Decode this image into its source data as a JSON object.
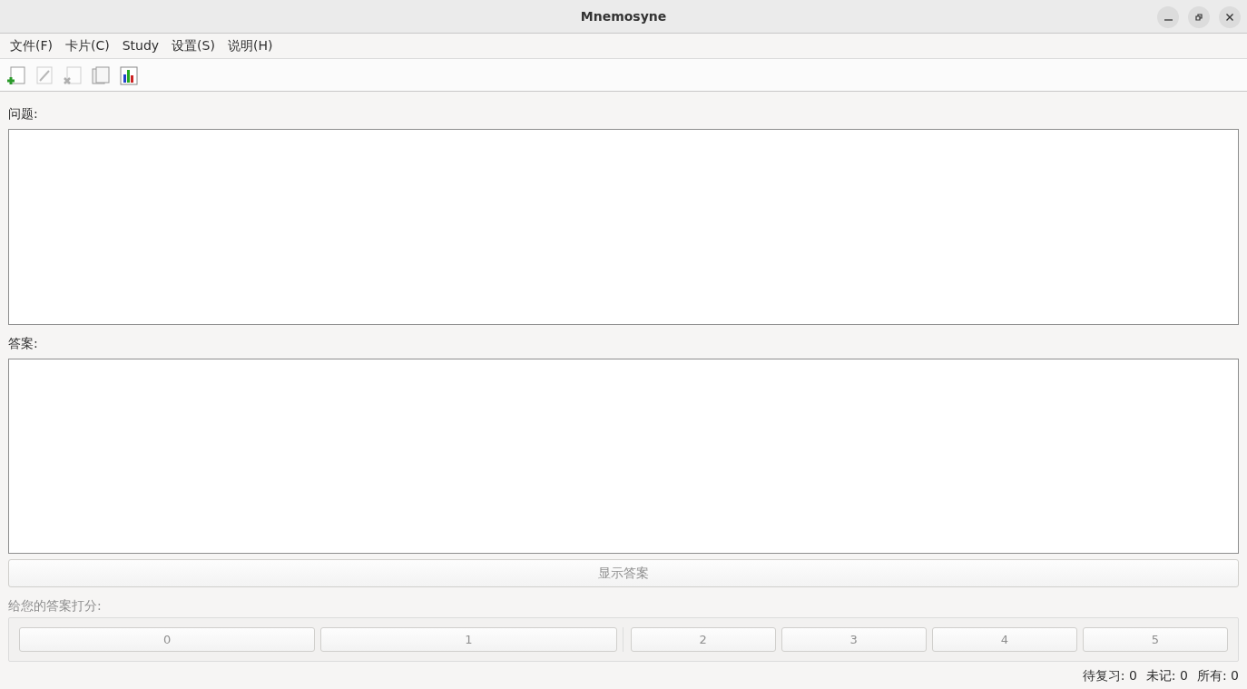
{
  "window": {
    "title": "Mnemosyne"
  },
  "menu": [
    {
      "label": "文件(F)"
    },
    {
      "label": "卡片(C)"
    },
    {
      "label": "Study"
    },
    {
      "label": "设置(S)"
    },
    {
      "label": "说明(H)"
    }
  ],
  "toolbar": [
    {
      "kind": "add",
      "disabled": false
    },
    {
      "kind": "edit",
      "disabled": true
    },
    {
      "kind": "delete",
      "disabled": true
    },
    {
      "kind": "copy",
      "disabled": false
    },
    {
      "kind": "stats",
      "disabled": false
    }
  ],
  "question": {
    "label": "问题:"
  },
  "answer": {
    "label": "答案:"
  },
  "show_answer": {
    "label": "显示答案",
    "disabled": true
  },
  "grading": {
    "label": "给您的答案打分:",
    "groups": [
      [
        {
          "label": "0",
          "disabled": true
        },
        {
          "label": "1",
          "disabled": true
        }
      ],
      [
        {
          "label": "2",
          "disabled": true
        },
        {
          "label": "3",
          "disabled": true
        },
        {
          "label": "4",
          "disabled": true
        },
        {
          "label": "5",
          "disabled": true
        }
      ]
    ]
  },
  "status_bar": [
    {
      "text": "待复习: 0"
    },
    {
      "text": "未记: 0"
    },
    {
      "text": "所有: 0"
    }
  ]
}
